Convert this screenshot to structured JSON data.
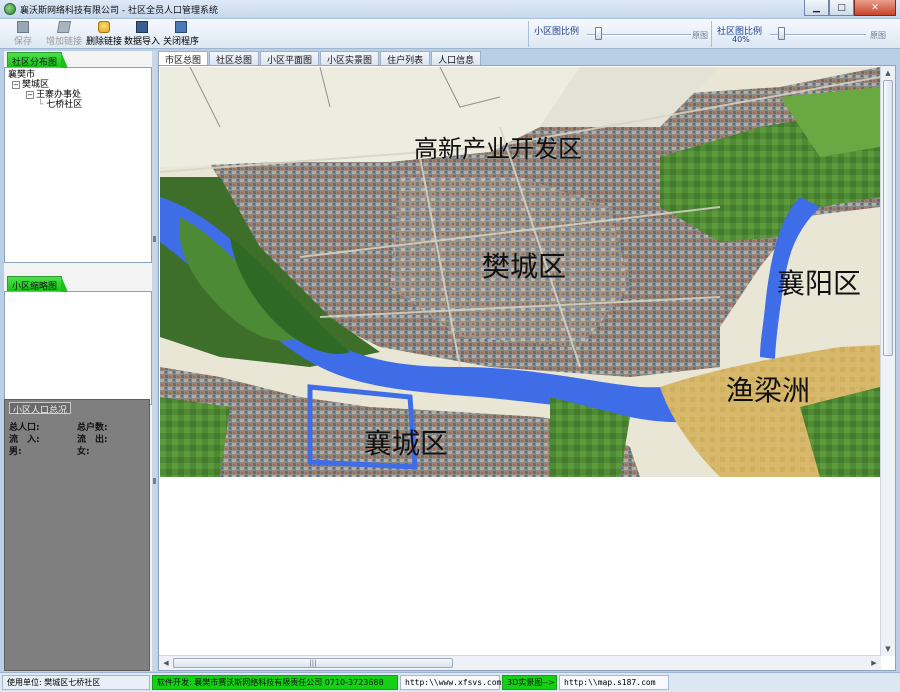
{
  "window": {
    "title": "襄沃斯网络科技有限公司 - 社区全员人口管理系统",
    "minimize_icon": "minimize-icon",
    "maximize_icon": "maximize-icon",
    "close_icon": "close-icon"
  },
  "toolbar": {
    "save_label": "保存",
    "add_link_label": "增加链接",
    "delete_link_label": "删除链接",
    "import_label": "数据导入",
    "exit_label": "关闭程序"
  },
  "scales": {
    "small": {
      "label": "小区图比例",
      "end_label": "原图",
      "value_fraction": 0.08
    },
    "community": {
      "label": "社区图比例",
      "sub": "40%",
      "end_label": "原图",
      "value_fraction": 0.08
    }
  },
  "left": {
    "distribution_tab": "社区分布图",
    "tree": {
      "root": "襄樊市",
      "district": "樊城区",
      "office": "王寨办事处",
      "community": "七桥社区",
      "toggle_symbol": "⊟"
    },
    "thumbnail_tab": "小区缩略图",
    "stats": {
      "tab": "小区人口总况",
      "total_pop": "总人口:",
      "total_house": "总户数:",
      "inflow": "流　入:",
      "outflow": "流　出:",
      "male": "男:",
      "female": "女:"
    }
  },
  "tabs": [
    "市区总图",
    "社区总图",
    "小区平面图",
    "小区实景图",
    "住户列表",
    "人口信息"
  ],
  "map": {
    "labels": {
      "gaoxin": "高新产业开发区",
      "fancheng": "樊城区",
      "xiangyang": "襄阳区",
      "yuliangzhou": "渔梁洲",
      "xiangcheng": "襄城区"
    }
  },
  "scroll": {
    "up": "▲",
    "down": "▼",
    "left": "◀",
    "right": "▶",
    "grip": "|||"
  },
  "status": {
    "unit": "使用单位: 樊城区七桥社区",
    "developer": "软件开发: 襄樊市赛沃斯网络科技有限责任公司 0710-3723688",
    "site": "http:\\\\www.xfsvs.com",
    "realview": "3D实景图-->",
    "map_site": "http:\\\\map.s187.com"
  }
}
